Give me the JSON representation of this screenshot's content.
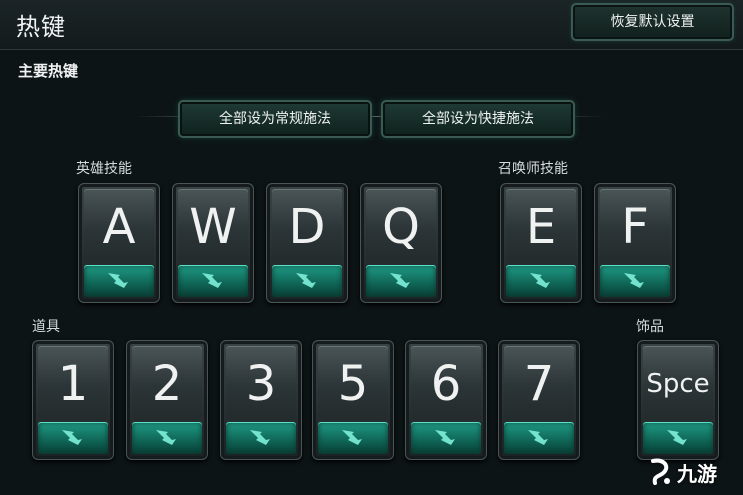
{
  "header": {
    "title": "热键",
    "reset_label": "恢复默认设置"
  },
  "section": {
    "title": "主要热键"
  },
  "mode_buttons": {
    "normal_cast": "全部设为常规施法",
    "quick_cast": "全部设为快捷施法"
  },
  "groups": {
    "hero_skills": {
      "label": "英雄技能",
      "keys": [
        "A",
        "W",
        "D",
        "Q"
      ]
    },
    "summoner_skills": {
      "label": "召唤师技能",
      "keys": [
        "E",
        "F"
      ]
    },
    "items": {
      "label": "道具",
      "keys": [
        "1",
        "2",
        "3",
        "5",
        "6",
        "7"
      ]
    },
    "trinket": {
      "label": "饰品",
      "keys": [
        "Spce"
      ]
    }
  },
  "watermark": {
    "text": "九游"
  },
  "colors": {
    "accent_teal": "#1f9c86",
    "background": "#0d1416"
  },
  "icons": {
    "quick_cast_arrow": "lightning-arrow-icon"
  }
}
